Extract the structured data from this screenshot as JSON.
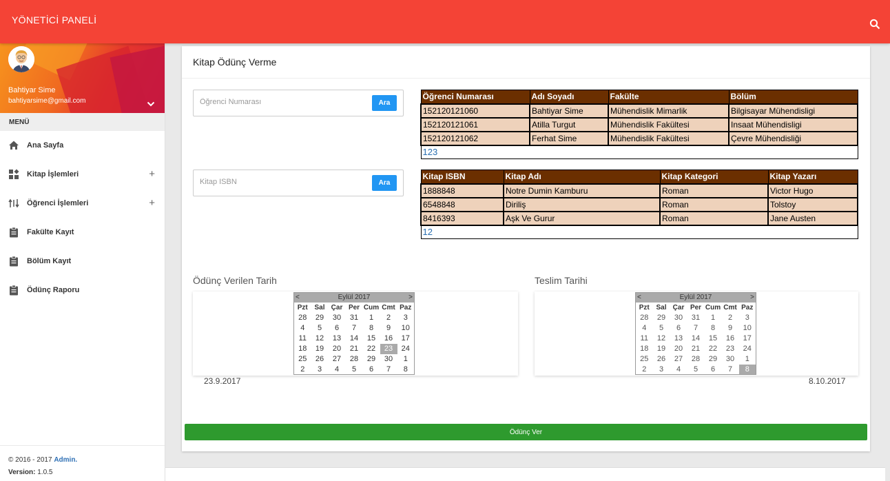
{
  "header": {
    "title": "YÖNETİCİ PANELİ"
  },
  "user": {
    "name": "Bahtiyar Sime",
    "email": "bahtiyarsime@gmail.com"
  },
  "menu": {
    "header": "MENÜ",
    "items": [
      {
        "label": "Ana Sayfa",
        "icon": "home-icon"
      },
      {
        "label": "Kitap İşlemleri",
        "icon": "widgets-icon",
        "expand": "+"
      },
      {
        "label": "Öğrenci İşlemleri",
        "icon": "swap-icon",
        "expand": "+"
      },
      {
        "label": "Fakülte Kayıt",
        "icon": "clipboard-icon"
      },
      {
        "label": "Bölüm Kayıt",
        "icon": "clipboard-icon"
      },
      {
        "label": "Ödünç Raporu",
        "icon": "clipboard-icon"
      }
    ]
  },
  "footer": {
    "copyright": "© 2016 - 2017",
    "admin": "Admin.",
    "version_label": "Version:",
    "version": "1.0.5"
  },
  "page": {
    "title": "Kitap Ödünç Verme"
  },
  "student_search": {
    "placeholder": "Öğrenci Numarası",
    "button": "Ara"
  },
  "book_search": {
    "placeholder": "Kitap ISBN",
    "button": "Ara"
  },
  "students": {
    "columns": [
      "Öğrenci Numarası",
      "Adı Soyadı",
      "Fakülte",
      "Bölüm"
    ],
    "rows": [
      [
        "152120121060",
        "Bahtiyar Sime",
        "Mühendislik Mimarlik",
        "Bilgisayar Mühendisligi"
      ],
      [
        "152120121061",
        "Atilla Turgut",
        "Mühendislik Fakültesi",
        "Insaat Mühendisligi"
      ],
      [
        "152120121062",
        "Ferhat Sime",
        "Mühendislik Fakültesi",
        "Çevre Mühendisliği"
      ]
    ],
    "pager": "123"
  },
  "books": {
    "columns": [
      "Kitap ISBN",
      "Kitap Adı",
      "Kitap Kategori",
      "Kitap Yazarı"
    ],
    "rows": [
      [
        "1888848",
        "Notre Dumin Kamburu",
        "Roman",
        "Victor Hugo"
      ],
      [
        "6548848",
        "Diriliş",
        "Roman",
        "Tolstoy"
      ],
      [
        "8416393",
        "Aşk Ve Gurur",
        "Roman",
        "Jane Austen"
      ]
    ],
    "pager": "12"
  },
  "loan_date": {
    "title": "Ödünç Verilen Tarih",
    "month": "Eylül 2017",
    "prev": "<",
    "next": ">",
    "days": [
      "Pzt",
      "Sal",
      "Çar",
      "Per",
      "Cum",
      "Cmt",
      "Paz"
    ],
    "weeks": [
      [
        "28",
        "29",
        "30",
        "31",
        "1",
        "2",
        "3"
      ],
      [
        "4",
        "5",
        "6",
        "7",
        "8",
        "9",
        "10"
      ],
      [
        "11",
        "12",
        "13",
        "14",
        "15",
        "16",
        "17"
      ],
      [
        "18",
        "19",
        "20",
        "21",
        "22",
        "23",
        "24"
      ],
      [
        "25",
        "26",
        "27",
        "28",
        "29",
        "30",
        "1"
      ],
      [
        "2",
        "3",
        "4",
        "5",
        "6",
        "7",
        "8"
      ]
    ],
    "selected": "23",
    "value": "23.9.2017"
  },
  "return_date": {
    "title": "Teslim Tarihi",
    "month": "Eylül 2017",
    "prev": "<",
    "next": ">",
    "days": [
      "Pzt",
      "Sal",
      "Çar",
      "Per",
      "Cum",
      "Cmt",
      "Paz"
    ],
    "weeks": [
      [
        "28",
        "29",
        "30",
        "31",
        "1",
        "2",
        "3"
      ],
      [
        "4",
        "5",
        "6",
        "7",
        "8",
        "9",
        "10"
      ],
      [
        "11",
        "12",
        "13",
        "14",
        "15",
        "16",
        "17"
      ],
      [
        "18",
        "19",
        "20",
        "21",
        "22",
        "23",
        "24"
      ],
      [
        "25",
        "26",
        "27",
        "28",
        "29",
        "30",
        "1"
      ],
      [
        "2",
        "3",
        "4",
        "5",
        "6",
        "7",
        "8"
      ]
    ],
    "selected": "8",
    "value": "8.10.2017"
  },
  "submit": {
    "label": "Ödünç Ver"
  },
  "colors": {
    "topbar": "#f44336",
    "table_header": "#6b2f00",
    "table_row": "#eed2bb",
    "button_blue": "#2196f3",
    "button_green": "#2e9a2e"
  }
}
